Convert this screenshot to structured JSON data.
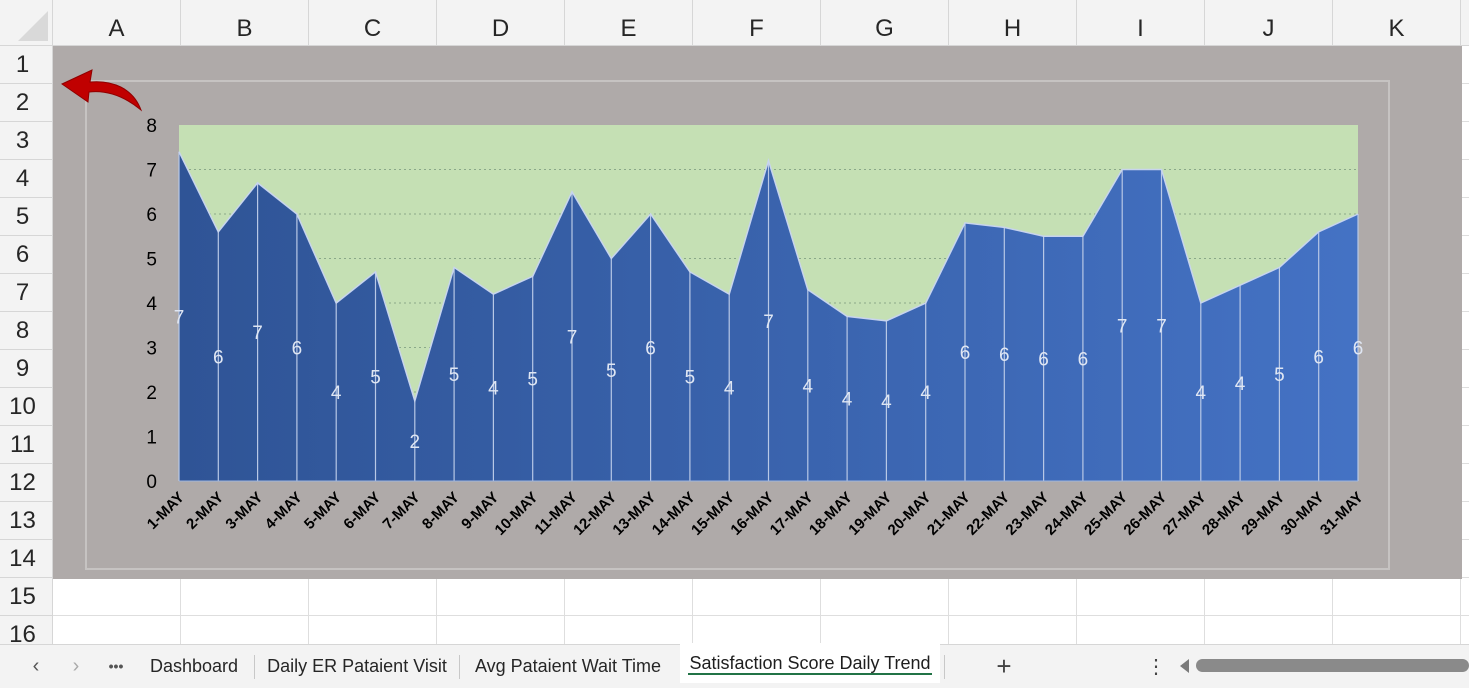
{
  "spreadsheet": {
    "columns": [
      "A",
      "B",
      "C",
      "D",
      "E",
      "F",
      "G",
      "H",
      "I",
      "J",
      "K"
    ],
    "rows": [
      "1",
      "2",
      "3",
      "4",
      "5",
      "6",
      "7",
      "8",
      "9",
      "10",
      "11",
      "12",
      "13",
      "14",
      "15",
      "16"
    ]
  },
  "sheet_tabs": {
    "more_label": "•••",
    "tabs": [
      {
        "label": "Dashboard",
        "active": false
      },
      {
        "label": "Daily ER Pataient Visit",
        "active": false
      },
      {
        "label": "Avg Pataient Wait Time",
        "active": false
      },
      {
        "label": "Satisfaction Score Daily Trend",
        "active": true
      }
    ],
    "add_label": "+"
  },
  "back_arrow": {
    "icon": "curved-back-arrow-icon",
    "color": "#c00000"
  },
  "colors": {
    "chart_object_bg": "#afaaa9",
    "target_fill": "#c5e0b4",
    "area_fill_dark": "#2f5496",
    "area_fill_light": "#4472c4",
    "active_tab_accent": "#217346"
  },
  "chart_data": {
    "type": "area",
    "x": [
      "1-MAY",
      "2-MAY",
      "3-MAY",
      "4-MAY",
      "5-MAY",
      "6-MAY",
      "7-MAY",
      "8-MAY",
      "9-MAY",
      "10-MAY",
      "11-MAY",
      "12-MAY",
      "13-MAY",
      "14-MAY",
      "15-MAY",
      "16-MAY",
      "17-MAY",
      "18-MAY",
      "19-MAY",
      "20-MAY",
      "21-MAY",
      "22-MAY",
      "23-MAY",
      "24-MAY",
      "25-MAY",
      "26-MAY",
      "27-MAY",
      "28-MAY",
      "29-MAY",
      "30-MAY",
      "31-MAY"
    ],
    "series": [
      {
        "values": [
          7.4,
          5.6,
          6.7,
          6.0,
          4.0,
          4.7,
          1.8,
          4.8,
          4.2,
          4.6,
          6.5,
          5.0,
          6.0,
          4.7,
          4.2,
          7.2,
          4.3,
          3.7,
          3.6,
          4.0,
          5.8,
          5.7,
          5.5,
          5.5,
          7.0,
          7.0,
          4.0,
          4.4,
          4.8,
          5.6,
          6.0
        ]
      },
      {
        "values": [
          8,
          8,
          8,
          8,
          8,
          8,
          8,
          8,
          8,
          8,
          8,
          8,
          8,
          8,
          8,
          8,
          8,
          8,
          8,
          8,
          8,
          8,
          8,
          8,
          8,
          8,
          8,
          8,
          8,
          8,
          8
        ]
      }
    ],
    "data_labels": [
      "7",
      "6",
      "7",
      "6",
      "4",
      "5",
      "2",
      "5",
      "4",
      "5",
      "7",
      "5",
      "6",
      "5",
      "4",
      "7",
      "4",
      "4",
      "4",
      "4",
      "6",
      "6",
      "6",
      "6",
      "7",
      "7",
      "4",
      "4",
      "5",
      "6",
      "6"
    ],
    "y_ticks": [
      "0",
      "1",
      "2",
      "3",
      "4",
      "5",
      "6",
      "7",
      "8"
    ],
    "ylim": [
      0,
      8
    ],
    "grid": true,
    "legend": "none"
  }
}
